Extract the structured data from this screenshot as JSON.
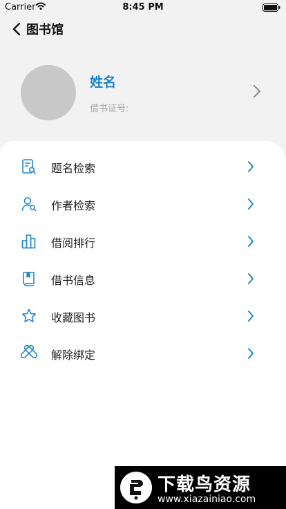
{
  "status_bar": {
    "carrier": "Carrier",
    "time": "8:45 PM"
  },
  "nav": {
    "title": "图书馆"
  },
  "profile": {
    "name": "姓名",
    "card_label": "借书证号:"
  },
  "menu": {
    "items": [
      {
        "label": "题名检索",
        "icon": "title-search-icon"
      },
      {
        "label": "作者检索",
        "icon": "author-search-icon"
      },
      {
        "label": "借阅排行",
        "icon": "ranking-chart-icon"
      },
      {
        "label": "借书信息",
        "icon": "borrow-book-icon"
      },
      {
        "label": "收藏图书",
        "icon": "star-icon"
      },
      {
        "label": "解除绑定",
        "icon": "unbind-icon"
      }
    ]
  },
  "watermark": {
    "title": "下载鸟资源",
    "url": "www.xiazainiao.com"
  },
  "colors": {
    "accent": "#1f86c8",
    "background": "#f2f2f2",
    "card": "#ffffff"
  }
}
